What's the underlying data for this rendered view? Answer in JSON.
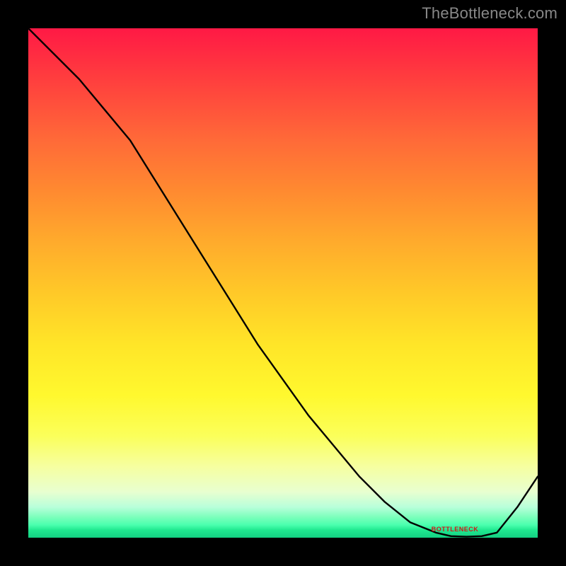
{
  "watermark": "TheBottleneck.com",
  "chart_data": {
    "type": "line",
    "title": "",
    "xlabel": "",
    "ylabel": "",
    "xlim": [
      0,
      100
    ],
    "ylim": [
      0,
      100
    ],
    "x": [
      0,
      5,
      10,
      15,
      20,
      25,
      30,
      35,
      40,
      45,
      50,
      55,
      60,
      65,
      70,
      75,
      80,
      83,
      86,
      89,
      92,
      96,
      100
    ],
    "values": [
      100,
      95,
      90,
      84,
      78,
      70,
      62,
      54,
      46,
      38,
      31,
      24,
      18,
      12,
      7,
      3,
      1,
      0.3,
      0.2,
      0.3,
      1,
      6,
      12
    ],
    "gradient_colors": {
      "top": "#ff1945",
      "mid_upper": "#ffab2c",
      "mid": "#fff82e",
      "mid_lower": "#e8ffd0",
      "bottom": "#13d082"
    },
    "annotations": [
      {
        "text": "BOTTLENECK",
        "x": 84,
        "y": 1.5
      }
    ]
  }
}
